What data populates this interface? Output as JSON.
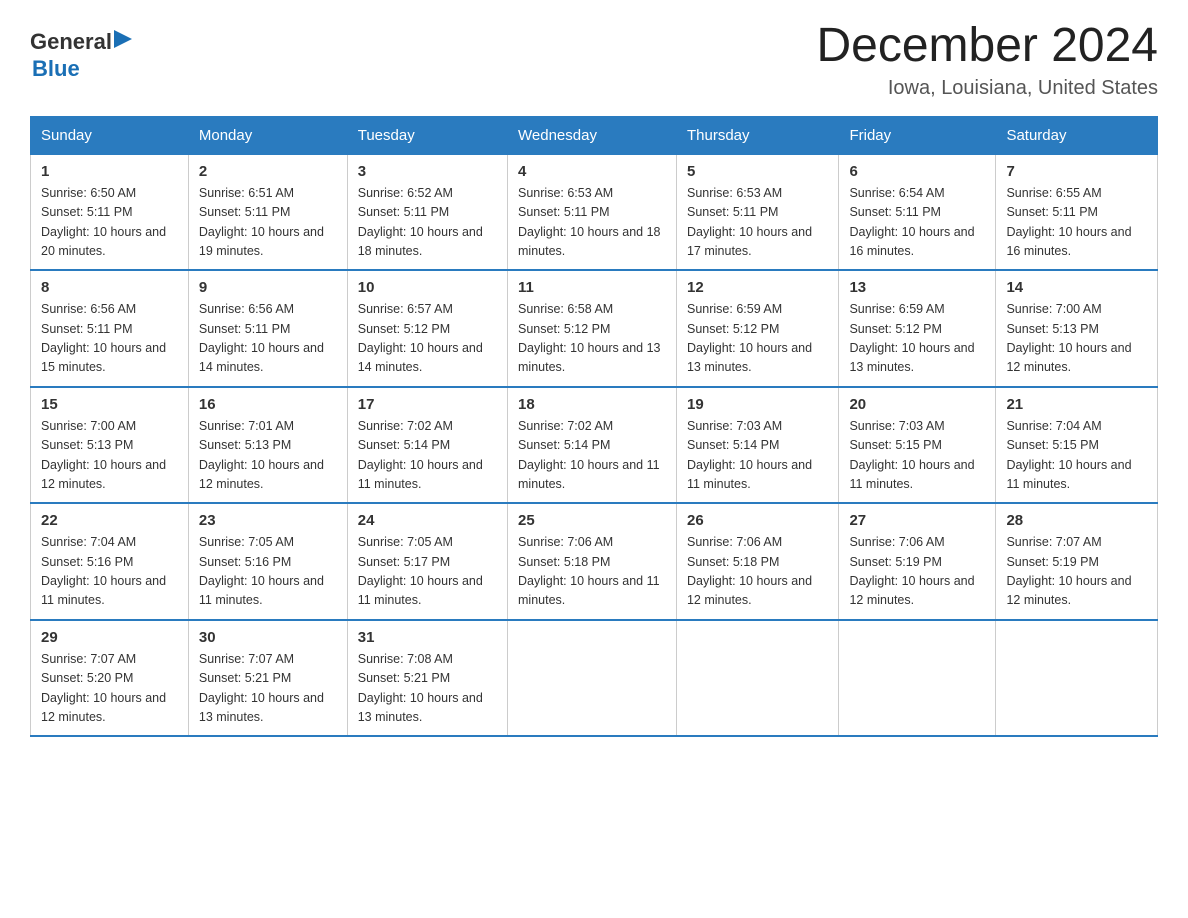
{
  "header": {
    "logo": {
      "general": "General",
      "arrow": "",
      "blue": "Blue"
    },
    "title": "December 2024",
    "subtitle": "Iowa, Louisiana, United States"
  },
  "calendar": {
    "days_of_week": [
      "Sunday",
      "Monday",
      "Tuesday",
      "Wednesday",
      "Thursday",
      "Friday",
      "Saturday"
    ],
    "weeks": [
      [
        {
          "day": "1",
          "sunrise": "6:50 AM",
          "sunset": "5:11 PM",
          "daylight": "10 hours and 20 minutes."
        },
        {
          "day": "2",
          "sunrise": "6:51 AM",
          "sunset": "5:11 PM",
          "daylight": "10 hours and 19 minutes."
        },
        {
          "day": "3",
          "sunrise": "6:52 AM",
          "sunset": "5:11 PM",
          "daylight": "10 hours and 18 minutes."
        },
        {
          "day": "4",
          "sunrise": "6:53 AM",
          "sunset": "5:11 PM",
          "daylight": "10 hours and 18 minutes."
        },
        {
          "day": "5",
          "sunrise": "6:53 AM",
          "sunset": "5:11 PM",
          "daylight": "10 hours and 17 minutes."
        },
        {
          "day": "6",
          "sunrise": "6:54 AM",
          "sunset": "5:11 PM",
          "daylight": "10 hours and 16 minutes."
        },
        {
          "day": "7",
          "sunrise": "6:55 AM",
          "sunset": "5:11 PM",
          "daylight": "10 hours and 16 minutes."
        }
      ],
      [
        {
          "day": "8",
          "sunrise": "6:56 AM",
          "sunset": "5:11 PM",
          "daylight": "10 hours and 15 minutes."
        },
        {
          "day": "9",
          "sunrise": "6:56 AM",
          "sunset": "5:11 PM",
          "daylight": "10 hours and 14 minutes."
        },
        {
          "day": "10",
          "sunrise": "6:57 AM",
          "sunset": "5:12 PM",
          "daylight": "10 hours and 14 minutes."
        },
        {
          "day": "11",
          "sunrise": "6:58 AM",
          "sunset": "5:12 PM",
          "daylight": "10 hours and 13 minutes."
        },
        {
          "day": "12",
          "sunrise": "6:59 AM",
          "sunset": "5:12 PM",
          "daylight": "10 hours and 13 minutes."
        },
        {
          "day": "13",
          "sunrise": "6:59 AM",
          "sunset": "5:12 PM",
          "daylight": "10 hours and 13 minutes."
        },
        {
          "day": "14",
          "sunrise": "7:00 AM",
          "sunset": "5:13 PM",
          "daylight": "10 hours and 12 minutes."
        }
      ],
      [
        {
          "day": "15",
          "sunrise": "7:00 AM",
          "sunset": "5:13 PM",
          "daylight": "10 hours and 12 minutes."
        },
        {
          "day": "16",
          "sunrise": "7:01 AM",
          "sunset": "5:13 PM",
          "daylight": "10 hours and 12 minutes."
        },
        {
          "day": "17",
          "sunrise": "7:02 AM",
          "sunset": "5:14 PM",
          "daylight": "10 hours and 11 minutes."
        },
        {
          "day": "18",
          "sunrise": "7:02 AM",
          "sunset": "5:14 PM",
          "daylight": "10 hours and 11 minutes."
        },
        {
          "day": "19",
          "sunrise": "7:03 AM",
          "sunset": "5:14 PM",
          "daylight": "10 hours and 11 minutes."
        },
        {
          "day": "20",
          "sunrise": "7:03 AM",
          "sunset": "5:15 PM",
          "daylight": "10 hours and 11 minutes."
        },
        {
          "day": "21",
          "sunrise": "7:04 AM",
          "sunset": "5:15 PM",
          "daylight": "10 hours and 11 minutes."
        }
      ],
      [
        {
          "day": "22",
          "sunrise": "7:04 AM",
          "sunset": "5:16 PM",
          "daylight": "10 hours and 11 minutes."
        },
        {
          "day": "23",
          "sunrise": "7:05 AM",
          "sunset": "5:16 PM",
          "daylight": "10 hours and 11 minutes."
        },
        {
          "day": "24",
          "sunrise": "7:05 AM",
          "sunset": "5:17 PM",
          "daylight": "10 hours and 11 minutes."
        },
        {
          "day": "25",
          "sunrise": "7:06 AM",
          "sunset": "5:18 PM",
          "daylight": "10 hours and 11 minutes."
        },
        {
          "day": "26",
          "sunrise": "7:06 AM",
          "sunset": "5:18 PM",
          "daylight": "10 hours and 12 minutes."
        },
        {
          "day": "27",
          "sunrise": "7:06 AM",
          "sunset": "5:19 PM",
          "daylight": "10 hours and 12 minutes."
        },
        {
          "day": "28",
          "sunrise": "7:07 AM",
          "sunset": "5:19 PM",
          "daylight": "10 hours and 12 minutes."
        }
      ],
      [
        {
          "day": "29",
          "sunrise": "7:07 AM",
          "sunset": "5:20 PM",
          "daylight": "10 hours and 12 minutes."
        },
        {
          "day": "30",
          "sunrise": "7:07 AM",
          "sunset": "5:21 PM",
          "daylight": "10 hours and 13 minutes."
        },
        {
          "day": "31",
          "sunrise": "7:08 AM",
          "sunset": "5:21 PM",
          "daylight": "10 hours and 13 minutes."
        },
        null,
        null,
        null,
        null
      ]
    ]
  }
}
